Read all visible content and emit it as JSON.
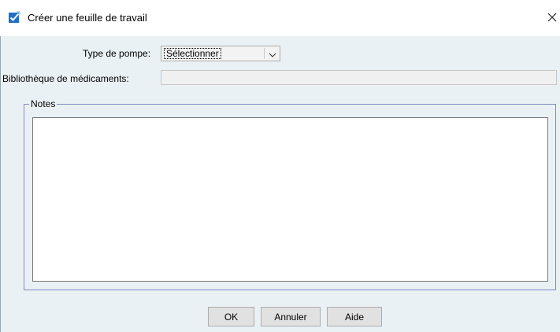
{
  "window": {
    "title": "Créer une feuille de travail",
    "icon": "checkbox-checked-icon",
    "close_icon": "close-icon"
  },
  "form": {
    "pump_type_label": "Type de pompe:",
    "pump_type_value": "Sélectionner",
    "library_label": "Bibliothèque de médicaments:",
    "library_value": "",
    "notes_legend": "Notes",
    "notes_value": ""
  },
  "buttons": {
    "ok": "OK",
    "cancel": "Annuler",
    "help": "Aide"
  },
  "colors": {
    "content_bg": "#eaf1f5",
    "group_border": "#7f8bc1",
    "icon_blue": "#1f6fc5"
  }
}
